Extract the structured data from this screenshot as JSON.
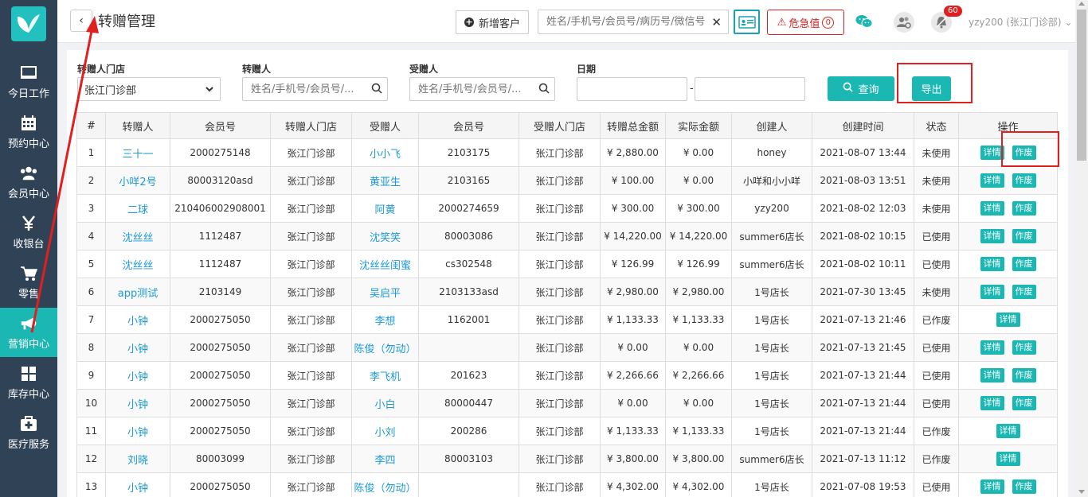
{
  "sidebar": {
    "items": [
      {
        "label": "今日工作",
        "icon": "monitor-icon"
      },
      {
        "label": "预约中心",
        "icon": "calendar-icon"
      },
      {
        "label": "会员中心",
        "icon": "users-icon"
      },
      {
        "label": "收银台",
        "icon": "yen-icon"
      },
      {
        "label": "零售",
        "icon": "cart-icon"
      },
      {
        "label": "营销中心",
        "icon": "megaphone-icon"
      },
      {
        "label": "库存中心",
        "icon": "grid-icon"
      },
      {
        "label": "医疗服务",
        "icon": "medical-kit-icon"
      }
    ],
    "active_index": 5
  },
  "header": {
    "title": "转赠管理",
    "new_customer": "新增客户",
    "search_placeholder": "姓名/手机号/会员号/病历号/微信号",
    "critical": "危急值",
    "critical_count": "0",
    "notification_count": "60",
    "user": "yzy200 (张江门诊部)"
  },
  "filters": {
    "store_label": "转赠人门店",
    "store_value": "张江门诊部",
    "giver_label": "转赠人",
    "giver_placeholder": "姓名/手机号/会员号/...",
    "receiver_label": "受赠人",
    "receiver_placeholder": "姓名/手机号/会员号/...",
    "date_label": "日期",
    "date_sep": "-",
    "query": "查询",
    "export": "导出"
  },
  "table": {
    "columns": [
      "#",
      "转赠人",
      "会员号",
      "转赠人门店",
      "受赠人",
      "会员号",
      "受赠人门店",
      "转赠总金额",
      "实际金额",
      "创建人",
      "创建时间",
      "状态",
      "操作"
    ],
    "detail_label": "详情",
    "void_label": "作废",
    "rows": [
      {
        "no": "1",
        "giver": "三十一",
        "giver_id": "2000275148",
        "giver_store": "张江门诊部",
        "receiver": "小小飞",
        "receiver_id": "2103175",
        "receiver_store": "张江门诊部",
        "total": "¥ 2,880.00",
        "actual": "¥ 0.00",
        "creator": "honey",
        "time": "2021-08-07 13:44",
        "status": "未使用",
        "can_void": true
      },
      {
        "no": "2",
        "giver": "小咩2号",
        "giver_id": "80003120asd",
        "giver_store": "张江门诊部",
        "receiver": "黄亚生",
        "receiver_id": "2103165",
        "receiver_store": "张江门诊部",
        "total": "¥ 100.00",
        "actual": "¥ 0.00",
        "creator": "小咩和小小咩",
        "time": "2021-08-03 13:51",
        "status": "未使用",
        "can_void": true
      },
      {
        "no": "3",
        "giver": "二球",
        "giver_id": "210406002908001",
        "giver_store": "张江门诊部",
        "receiver": "阿黄",
        "receiver_id": "2000274659",
        "receiver_store": "张江门诊部",
        "total": "¥ 300.00",
        "actual": "¥ 300.00",
        "creator": "yzy200",
        "time": "2021-08-02 12:03",
        "status": "未使用",
        "can_void": true
      },
      {
        "no": "4",
        "giver": "沈丝丝",
        "giver_id": "1112487",
        "giver_store": "张江门诊部",
        "receiver": "沈笑笑",
        "receiver_id": "80003086",
        "receiver_store": "张江门诊部",
        "total": "¥ 14,220.00",
        "actual": "¥ 14,220.00",
        "creator": "summer6店长",
        "time": "2021-08-02 10:15",
        "status": "已使用",
        "can_void": true
      },
      {
        "no": "5",
        "giver": "沈丝丝",
        "giver_id": "1112487",
        "giver_store": "张江门诊部",
        "receiver": "沈丝丝闺蜜",
        "receiver_id": "cs302548",
        "receiver_store": "张江门诊部",
        "total": "¥ 126.99",
        "actual": "¥ 126.99",
        "creator": "summer6店长",
        "time": "2021-08-02 10:11",
        "status": "已使用",
        "can_void": true
      },
      {
        "no": "6",
        "giver": "app测试",
        "giver_id": "2103149",
        "giver_store": "张江门诊部",
        "receiver": "吴启平",
        "receiver_id": "2103133asd",
        "receiver_store": "张江门诊部",
        "total": "¥ 2,980.00",
        "actual": "¥ 2,980.00",
        "creator": "1号店长",
        "time": "2021-07-30 13:45",
        "status": "未使用",
        "can_void": true
      },
      {
        "no": "7",
        "giver": "小钟",
        "giver_id": "2000275050",
        "giver_store": "张江门诊部",
        "receiver": "李想",
        "receiver_id": "1162001",
        "receiver_store": "张江门诊部",
        "total": "¥ 1,133.33",
        "actual": "¥ 1,133.33",
        "creator": "1号店长",
        "time": "2021-07-13 21:46",
        "status": "已作废",
        "can_void": false
      },
      {
        "no": "8",
        "giver": "小钟",
        "giver_id": "2000275050",
        "giver_store": "张江门诊部",
        "receiver": "陈俊（勿动）",
        "receiver_id": "",
        "receiver_store": "张江门诊部",
        "total": "¥ 0.00",
        "actual": "¥ 0.00",
        "creator": "1号店长",
        "time": "2021-07-13 21:45",
        "status": "已使用",
        "can_void": true
      },
      {
        "no": "9",
        "giver": "小钟",
        "giver_id": "2000275050",
        "giver_store": "张江门诊部",
        "receiver": "李飞机",
        "receiver_id": "201623",
        "receiver_store": "张江门诊部",
        "total": "¥ 2,266.66",
        "actual": "¥ 2,266.66",
        "creator": "1号店长",
        "time": "2021-07-13 21:44",
        "status": "已使用",
        "can_void": true
      },
      {
        "no": "10",
        "giver": "小钟",
        "giver_id": "2000275050",
        "giver_store": "张江门诊部",
        "receiver": "小白",
        "receiver_id": "80000447",
        "receiver_store": "张江门诊部",
        "total": "¥ 0.00",
        "actual": "¥ 0.00",
        "creator": "1号店长",
        "time": "2021-07-13 21:44",
        "status": "已使用",
        "can_void": true
      },
      {
        "no": "11",
        "giver": "小钟",
        "giver_id": "2000275050",
        "giver_store": "张江门诊部",
        "receiver": "小刘",
        "receiver_id": "200286",
        "receiver_store": "张江门诊部",
        "total": "¥ 1,133.33",
        "actual": "¥ 1,133.33",
        "creator": "1号店长",
        "time": "2021-07-13 21:44",
        "status": "已作废",
        "can_void": false
      },
      {
        "no": "12",
        "giver": "刘晓",
        "giver_id": "80003099",
        "giver_store": "张江门诊部",
        "receiver": "李四",
        "receiver_id": "80003103",
        "receiver_store": "张江门诊部",
        "total": "¥ 3,800.00",
        "actual": "¥ 3,800.00",
        "creator": "summer6店长",
        "time": "2021-07-13 11:12",
        "status": "已作废",
        "can_void": false
      },
      {
        "no": "13",
        "giver": "小钟",
        "giver_id": "2000275050",
        "giver_store": "张江门诊部",
        "receiver": "陈俊（勿动）",
        "receiver_id": "",
        "receiver_store": "张江门诊部",
        "total": "¥ 4,302.00",
        "actual": "¥ 4,302.00",
        "creator": "1号店长",
        "time": "2021-07-08 19:53",
        "status": "已使用",
        "can_void": true
      }
    ]
  },
  "colors": {
    "sidebar_bg": "#2f4256",
    "accent": "#1ab7b3",
    "link": "#1b9ad6",
    "danger": "#e02020"
  }
}
